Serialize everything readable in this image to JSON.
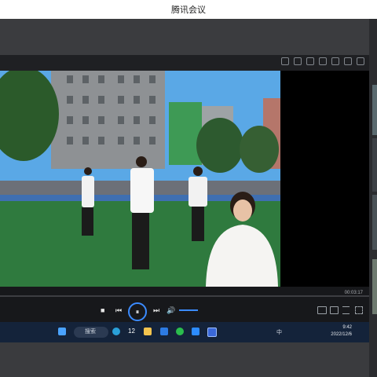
{
  "window": {
    "title": "腾讯会议"
  },
  "player": {
    "time": "00:03:17",
    "icons": [
      "shield-icon",
      "lock-icon",
      "pin-icon",
      "back-icon",
      "minimize-icon",
      "restore-icon",
      "close-icon"
    ],
    "controls": {
      "stop": "■",
      "prev": "⏮",
      "play": "⏸",
      "next": "⏭",
      "volume": "🔊"
    },
    "right_controls": [
      "quality-icon",
      "share-icon",
      "settings-icon",
      "fullscreen-icon"
    ]
  },
  "taskbar": {
    "search_label": "搜索",
    "num_label": "12",
    "ime": "中",
    "time": "9:42",
    "date": "2022/12/6"
  },
  "colors": {
    "accent": "#3b8bff",
    "grass": "#2f7a3e",
    "sky": "#5aa8e6"
  }
}
